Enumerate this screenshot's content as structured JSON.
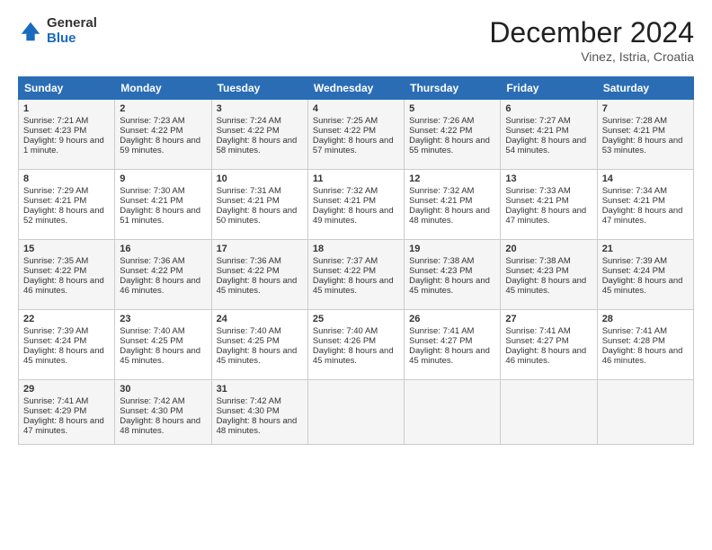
{
  "header": {
    "logo_general": "General",
    "logo_blue": "Blue",
    "title": "December 2024",
    "location": "Vinez, Istria, Croatia"
  },
  "days_of_week": [
    "Sunday",
    "Monday",
    "Tuesday",
    "Wednesday",
    "Thursday",
    "Friday",
    "Saturday"
  ],
  "weeks": [
    [
      {
        "day": 1,
        "sunrise": "7:21 AM",
        "sunset": "4:23 PM",
        "daylight": "Daylight: 9 hours and 1 minute."
      },
      {
        "day": 2,
        "sunrise": "7:23 AM",
        "sunset": "4:22 PM",
        "daylight": "Daylight: 8 hours and 59 minutes."
      },
      {
        "day": 3,
        "sunrise": "7:24 AM",
        "sunset": "4:22 PM",
        "daylight": "Daylight: 8 hours and 58 minutes."
      },
      {
        "day": 4,
        "sunrise": "7:25 AM",
        "sunset": "4:22 PM",
        "daylight": "Daylight: 8 hours and 57 minutes."
      },
      {
        "day": 5,
        "sunrise": "7:26 AM",
        "sunset": "4:22 PM",
        "daylight": "Daylight: 8 hours and 55 minutes."
      },
      {
        "day": 6,
        "sunrise": "7:27 AM",
        "sunset": "4:21 PM",
        "daylight": "Daylight: 8 hours and 54 minutes."
      },
      {
        "day": 7,
        "sunrise": "7:28 AM",
        "sunset": "4:21 PM",
        "daylight": "Daylight: 8 hours and 53 minutes."
      }
    ],
    [
      {
        "day": 8,
        "sunrise": "7:29 AM",
        "sunset": "4:21 PM",
        "daylight": "Daylight: 8 hours and 52 minutes."
      },
      {
        "day": 9,
        "sunrise": "7:30 AM",
        "sunset": "4:21 PM",
        "daylight": "Daylight: 8 hours and 51 minutes."
      },
      {
        "day": 10,
        "sunrise": "7:31 AM",
        "sunset": "4:21 PM",
        "daylight": "Daylight: 8 hours and 50 minutes."
      },
      {
        "day": 11,
        "sunrise": "7:32 AM",
        "sunset": "4:21 PM",
        "daylight": "Daylight: 8 hours and 49 minutes."
      },
      {
        "day": 12,
        "sunrise": "7:32 AM",
        "sunset": "4:21 PM",
        "daylight": "Daylight: 8 hours and 48 minutes."
      },
      {
        "day": 13,
        "sunrise": "7:33 AM",
        "sunset": "4:21 PM",
        "daylight": "Daylight: 8 hours and 47 minutes."
      },
      {
        "day": 14,
        "sunrise": "7:34 AM",
        "sunset": "4:21 PM",
        "daylight": "Daylight: 8 hours and 47 minutes."
      }
    ],
    [
      {
        "day": 15,
        "sunrise": "7:35 AM",
        "sunset": "4:22 PM",
        "daylight": "Daylight: 8 hours and 46 minutes."
      },
      {
        "day": 16,
        "sunrise": "7:36 AM",
        "sunset": "4:22 PM",
        "daylight": "Daylight: 8 hours and 46 minutes."
      },
      {
        "day": 17,
        "sunrise": "7:36 AM",
        "sunset": "4:22 PM",
        "daylight": "Daylight: 8 hours and 45 minutes."
      },
      {
        "day": 18,
        "sunrise": "7:37 AM",
        "sunset": "4:22 PM",
        "daylight": "Daylight: 8 hours and 45 minutes."
      },
      {
        "day": 19,
        "sunrise": "7:38 AM",
        "sunset": "4:23 PM",
        "daylight": "Daylight: 8 hours and 45 minutes."
      },
      {
        "day": 20,
        "sunrise": "7:38 AM",
        "sunset": "4:23 PM",
        "daylight": "Daylight: 8 hours and 45 minutes."
      },
      {
        "day": 21,
        "sunrise": "7:39 AM",
        "sunset": "4:24 PM",
        "daylight": "Daylight: 8 hours and 45 minutes."
      }
    ],
    [
      {
        "day": 22,
        "sunrise": "7:39 AM",
        "sunset": "4:24 PM",
        "daylight": "Daylight: 8 hours and 45 minutes."
      },
      {
        "day": 23,
        "sunrise": "7:40 AM",
        "sunset": "4:25 PM",
        "daylight": "Daylight: 8 hours and 45 minutes."
      },
      {
        "day": 24,
        "sunrise": "7:40 AM",
        "sunset": "4:25 PM",
        "daylight": "Daylight: 8 hours and 45 minutes."
      },
      {
        "day": 25,
        "sunrise": "7:40 AM",
        "sunset": "4:26 PM",
        "daylight": "Daylight: 8 hours and 45 minutes."
      },
      {
        "day": 26,
        "sunrise": "7:41 AM",
        "sunset": "4:27 PM",
        "daylight": "Daylight: 8 hours and 45 minutes."
      },
      {
        "day": 27,
        "sunrise": "7:41 AM",
        "sunset": "4:27 PM",
        "daylight": "Daylight: 8 hours and 46 minutes."
      },
      {
        "day": 28,
        "sunrise": "7:41 AM",
        "sunset": "4:28 PM",
        "daylight": "Daylight: 8 hours and 46 minutes."
      }
    ],
    [
      {
        "day": 29,
        "sunrise": "7:41 AM",
        "sunset": "4:29 PM",
        "daylight": "Daylight: 8 hours and 47 minutes."
      },
      {
        "day": 30,
        "sunrise": "7:42 AM",
        "sunset": "4:30 PM",
        "daylight": "Daylight: 8 hours and 48 minutes."
      },
      {
        "day": 31,
        "sunrise": "7:42 AM",
        "sunset": "4:30 PM",
        "daylight": "Daylight: 8 hours and 48 minutes."
      },
      null,
      null,
      null,
      null
    ]
  ]
}
